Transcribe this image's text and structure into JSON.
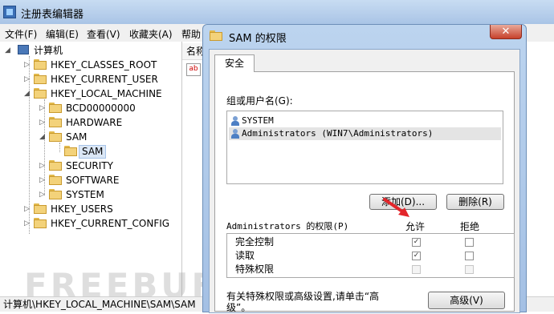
{
  "regedit": {
    "title": "注册表编辑器",
    "menu": [
      "文件(F)",
      "编辑(E)",
      "查看(V)",
      "收藏夹(A)",
      "帮助"
    ],
    "tree": {
      "root": "计算机",
      "items": [
        "HKEY_CLASSES_ROOT",
        "HKEY_CURRENT_USER",
        "HKEY_LOCAL_MACHINE",
        "BCD00000000",
        "HARDWARE",
        "SAM",
        "SAM",
        "SECURITY",
        "SOFTWARE",
        "SYSTEM",
        "HKEY_USERS",
        "HKEY_CURRENT_CONFIG"
      ]
    },
    "right_header": "名称",
    "status": "计算机\\HKEY_LOCAL_MACHINE\\SAM\\SAM",
    "watermark": "FREEBUF"
  },
  "dialog": {
    "title": "SAM 的权限",
    "close_glyph": "✕",
    "tab": "安全",
    "group_label": "组或用户名(G):",
    "users": [
      "SYSTEM",
      "Administrators (WIN7\\Administrators)"
    ],
    "add_button": "添加(D)...",
    "remove_button": "删除(R)",
    "perm_label": "Administrators 的权限(P)",
    "allow_header": "允许",
    "deny_header": "拒绝",
    "permissions": [
      {
        "name": "完全控制",
        "allow": true,
        "deny": false
      },
      {
        "name": "读取",
        "allow": true,
        "deny": false
      },
      {
        "name": "特殊权限",
        "allow": false,
        "deny": false
      }
    ],
    "advanced_text_1": "有关特殊权限或高级设置,请单击“高",
    "advanced_text_2": "级”。",
    "advanced_button": "高级(V)"
  },
  "colors": {
    "arrow": "#e3262b",
    "title_bar": "#b9d1ee"
  }
}
